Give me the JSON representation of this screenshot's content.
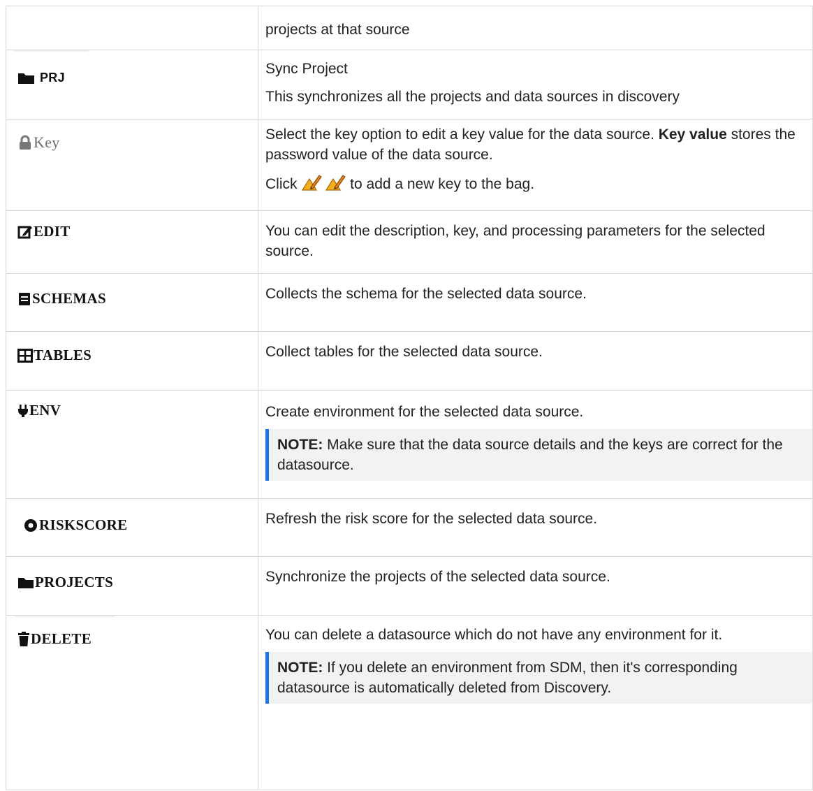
{
  "rows": [
    {
      "button": "",
      "icon": "",
      "paragraphs": [
        "projects at that source"
      ]
    },
    {
      "button": "PRJ",
      "icon": "folder-icon",
      "paragraphs": [
        "Sync Project",
        "This synchronizes all the projects and data sources in discovery"
      ]
    },
    {
      "button": "Key",
      "icon": "lock-icon",
      "p1_before": "Select the key option to edit a key value for the data source. ",
      "p1_bold": "Key value",
      "p1_after": " stores the password value of the data source.",
      "p2_before": "Click ",
      "p2_after": " to add a new key to the bag."
    },
    {
      "button": "EDIT",
      "icon": "edit-icon",
      "paragraphs": [
        "You can edit the description, key, and processing parameters for the selected source."
      ]
    },
    {
      "button": "SCHEMAS",
      "icon": "book-icon",
      "paragraphs": [
        "Collects the schema for the selected data source."
      ]
    },
    {
      "button": "TABLES",
      "icon": "table-icon",
      "paragraphs": [
        "Collect tables for the selected data source."
      ]
    },
    {
      "button": "ENV",
      "icon": "plug-icon",
      "paragraphs": [
        "Create environment for the selected data source."
      ],
      "note_label": "NOTE:",
      "note_text": " Make sure that the data source details and the keys are correct for the datasource."
    },
    {
      "button": "RISKSCORE",
      "icon": "circle-icon",
      "paragraphs": [
        "Refresh the risk score for the selected data source."
      ]
    },
    {
      "button": "PROJECTS",
      "icon": "folder-icon",
      "paragraphs": [
        "Synchronize the projects of the selected data source."
      ]
    },
    {
      "button": "DELETE",
      "icon": "trash-icon",
      "paragraphs": [
        "You can delete a datasource which do not have any environment for it."
      ],
      "note_label": "NOTE:",
      "note_text": " If you delete an environment from SDM, then it's corresponding datasource is automatically deleted from Discovery."
    }
  ],
  "colors": {
    "note_bar": "#1a73e8",
    "note_bg": "#f1f2f3",
    "border": "#d7d7d7",
    "pencil": "#f2b01e"
  }
}
